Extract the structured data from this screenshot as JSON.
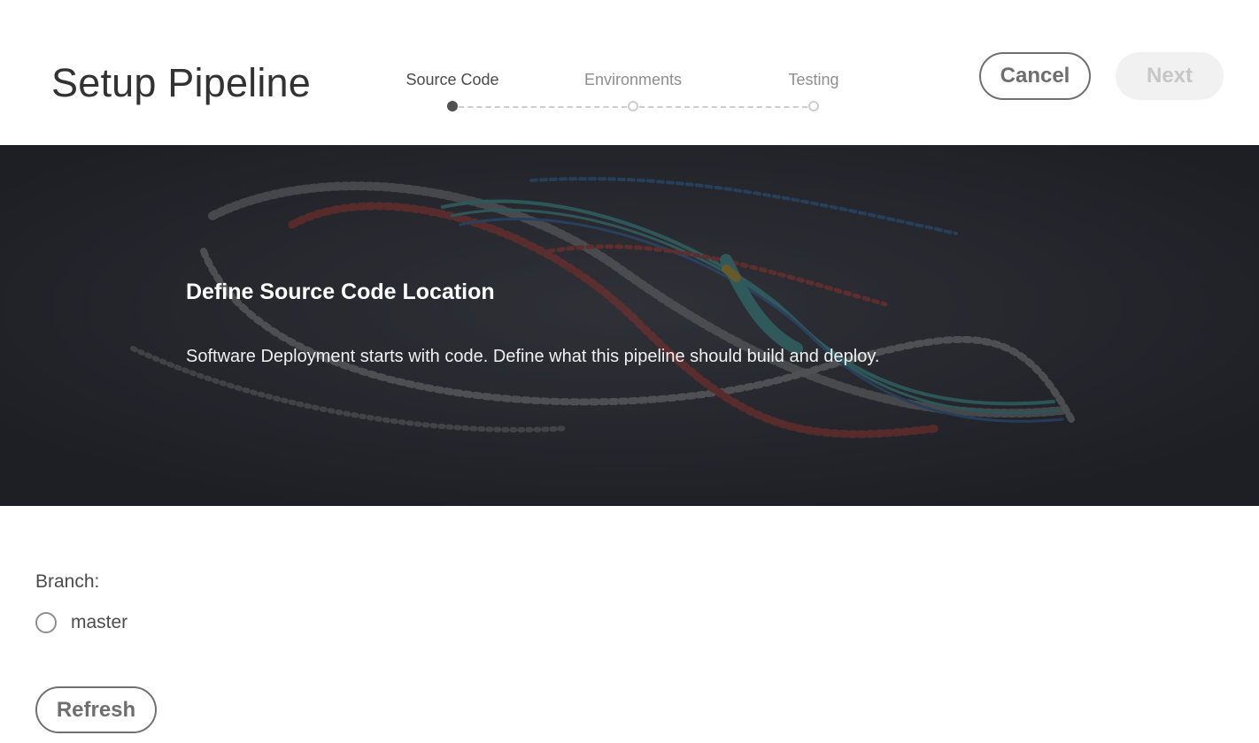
{
  "header": {
    "title": "Setup Pipeline",
    "cancel_label": "Cancel",
    "next_label": "Next"
  },
  "stepper": {
    "steps": [
      {
        "label": "Source Code",
        "state": "active"
      },
      {
        "label": "Environments",
        "state": "inactive"
      },
      {
        "label": "Testing",
        "state": "inactive"
      }
    ]
  },
  "hero": {
    "title": "Define Source Code Location",
    "description": "Software Deployment starts with code. Define what this pipeline should build and deploy."
  },
  "branch": {
    "label": "Branch:",
    "options": [
      {
        "label": "master",
        "selected": false
      }
    ],
    "refresh_label": "Refresh"
  },
  "colors": {
    "hero_background": "#23242a",
    "accent_red": "#c0392b",
    "accent_teal": "#3fb0a8",
    "accent_blue": "#2f6fb0"
  }
}
